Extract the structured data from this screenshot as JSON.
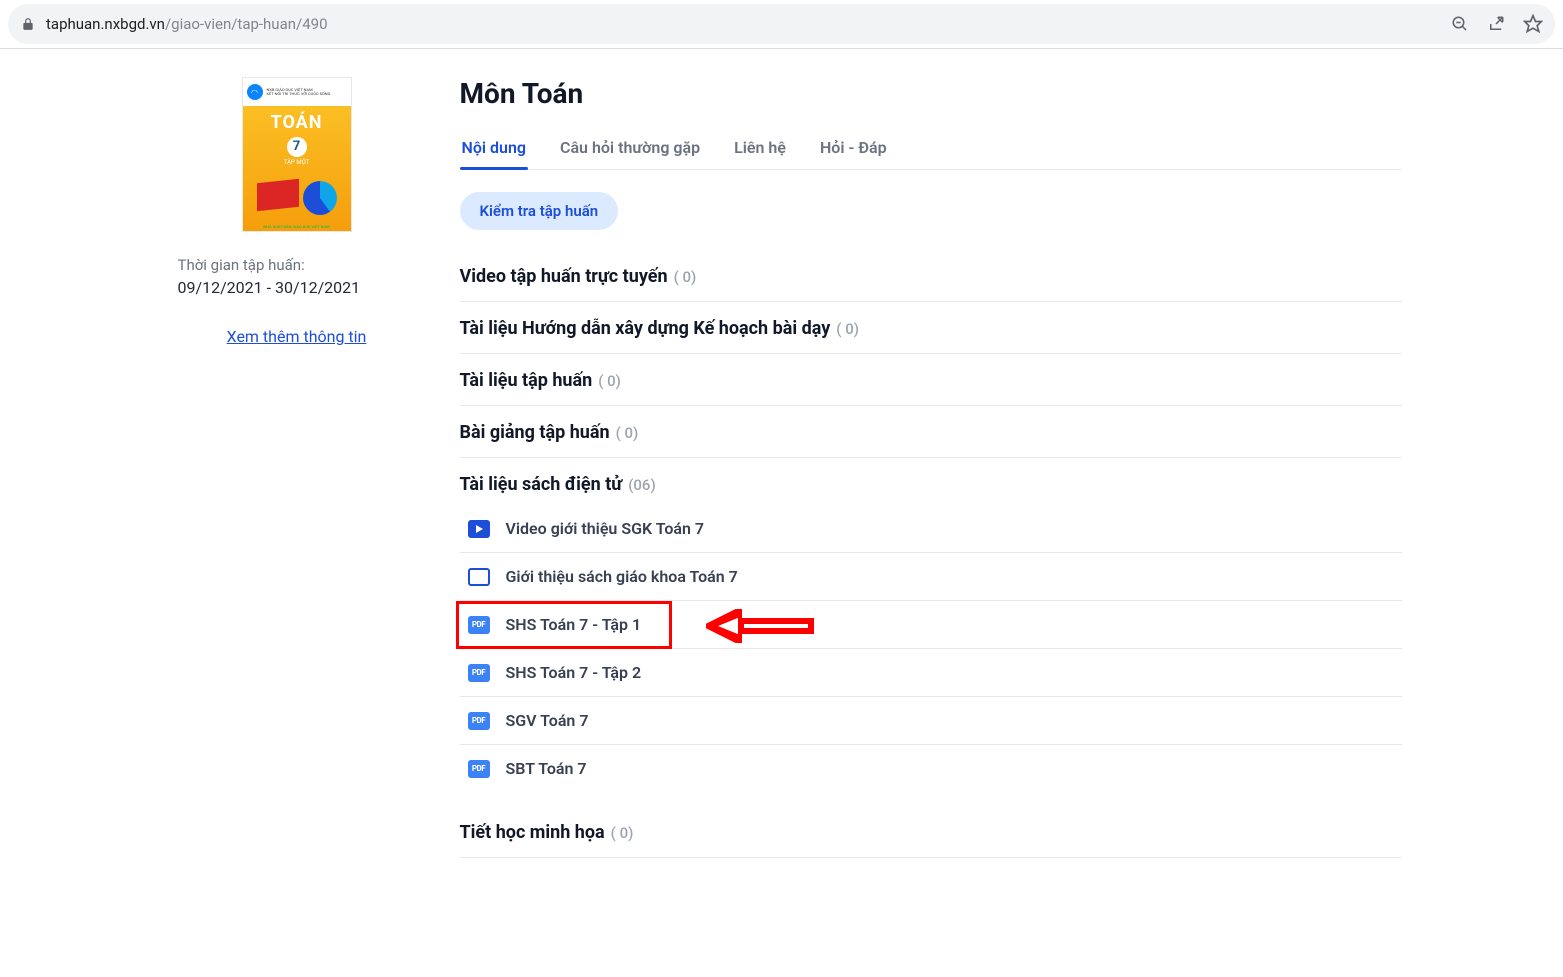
{
  "browser": {
    "url_host": "taphuan.nxbgd.vn",
    "url_path": "/giao-vien/tap-huan/490"
  },
  "sidebar": {
    "cover_title": "TOÁN",
    "cover_number": "7",
    "cover_sub": "TẬP MỘT",
    "period_label": "Thời gian tập huấn:",
    "period_value": "09/12/2021 - 30/12/2021",
    "more_link": "Xem thêm thông tin"
  },
  "main": {
    "title": "Môn Toán",
    "tabs": [
      "Nội dung",
      "Câu hỏi thường gặp",
      "Liên hệ",
      "Hỏi - Đáp"
    ],
    "active_tab": 0,
    "check_button": "Kiểm tra tập huấn",
    "sections": [
      {
        "title": "Video tập huấn trực tuyến",
        "count": "( 0)"
      },
      {
        "title": "Tài liệu Hướng dẫn xây dựng Kế hoạch bài dạy",
        "count": "( 0)"
      },
      {
        "title": "Tài liệu tập huấn",
        "count": "( 0)"
      },
      {
        "title": "Bài giảng tập huấn",
        "count": "( 0)"
      },
      {
        "title": "Tài liệu sách điện tử",
        "count": "(06)",
        "items": [
          {
            "icon": "play",
            "label": "Video giới thiệu SGK Toán 7"
          },
          {
            "icon": "doc",
            "label": "Giới thiệu sách giáo khoa Toán 7"
          },
          {
            "icon": "pdf",
            "label": "SHS Toán 7 - Tập 1",
            "highlight": true
          },
          {
            "icon": "pdf",
            "label": "SHS Toán 7 - Tập 2"
          },
          {
            "icon": "pdf",
            "label": "SGV Toán 7"
          },
          {
            "icon": "pdf",
            "label": "SBT Toán 7"
          }
        ]
      },
      {
        "title": "Tiết học minh họa",
        "count": "( 0)"
      }
    ],
    "pdf_badge": "PDF"
  }
}
